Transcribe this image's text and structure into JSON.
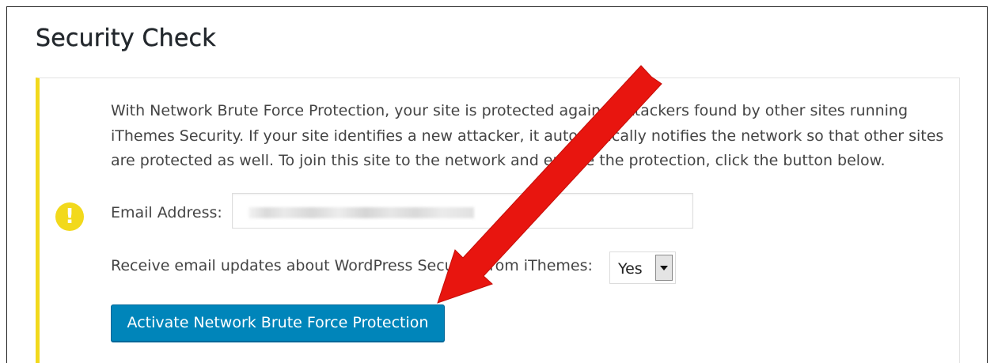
{
  "page": {
    "title": "Security Check"
  },
  "notice": {
    "description": "With Network Brute Force Protection, your site is protected against attackers found by other sites running iThemes Security. If your site identifies a new attacker, it automatically notifies the network so that other sites are protected as well. To join this site to the network and enable the protection, click the button below.",
    "icon": "warning-exclamation-icon",
    "accent_color": "#f2d91c",
    "email": {
      "label": "Email Address:",
      "value_redacted": true
    },
    "updates": {
      "label": "Receive email updates about WordPress Security from iThemes:",
      "selected": "Yes"
    },
    "activate_button": {
      "label": "Activate Network Brute Force Protection",
      "color": "#0085ba"
    }
  },
  "annotation": {
    "type": "red-arrow",
    "color": "#e8150f"
  }
}
